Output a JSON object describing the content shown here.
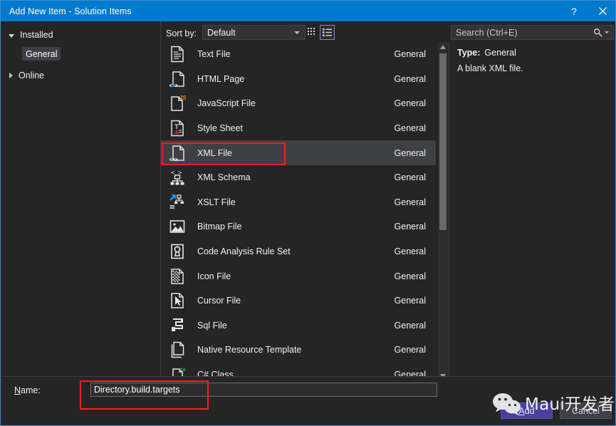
{
  "window": {
    "title": "Add New Item - Solution Items",
    "help_label": "?",
    "close_label": "✕",
    "accent_color": "#007acc",
    "background_color": "#252526"
  },
  "sidebar": {
    "items": [
      {
        "label": "Installed",
        "icon": "triangle-down-icon",
        "expanded": true
      },
      {
        "label": "General",
        "icon": "none",
        "selected": true
      },
      {
        "label": "Online",
        "icon": "triangle-right-icon",
        "expanded": false
      }
    ]
  },
  "toolbar": {
    "sort_label": "Sort by:",
    "sort_value": "Default",
    "view_tiles_icon": "grid-view-icon",
    "view_list_icon": "list-view-icon",
    "view_selected": "list"
  },
  "search": {
    "placeholder": "Search (Ctrl+E)",
    "icon": "magnifier-icon",
    "dropdown_icon": "chevron-down-icon"
  },
  "list": {
    "category_column": "General",
    "selected_index": 4,
    "items": [
      {
        "name": "Text File",
        "category": "General",
        "icon": "text-file-icon"
      },
      {
        "name": "HTML Page",
        "category": "General",
        "icon": "html-page-icon"
      },
      {
        "name": "JavaScript File",
        "category": "General",
        "icon": "javascript-file-icon"
      },
      {
        "name": "Style Sheet",
        "category": "General",
        "icon": "style-sheet-icon"
      },
      {
        "name": "XML File",
        "category": "General",
        "icon": "xml-file-icon"
      },
      {
        "name": "XML Schema",
        "category": "General",
        "icon": "xml-schema-icon"
      },
      {
        "name": "XSLT File",
        "category": "General",
        "icon": "xslt-file-icon"
      },
      {
        "name": "Bitmap File",
        "category": "General",
        "icon": "bitmap-file-icon"
      },
      {
        "name": "Code Analysis Rule Set",
        "category": "General",
        "icon": "rule-set-icon"
      },
      {
        "name": "Icon File",
        "category": "General",
        "icon": "icon-file-icon"
      },
      {
        "name": "Cursor File",
        "category": "General",
        "icon": "cursor-file-icon"
      },
      {
        "name": "Sql File",
        "category": "General",
        "icon": "sql-file-icon"
      },
      {
        "name": "Native Resource Template",
        "category": "General",
        "icon": "native-resource-icon"
      },
      {
        "name": "C# Class",
        "category": "General",
        "icon": "csharp-class-icon"
      }
    ]
  },
  "details": {
    "type_key": "Type:",
    "type_value": "General",
    "description": "A blank XML file."
  },
  "footer": {
    "name_label_prefix": "N",
    "name_label_rest": "ame:",
    "name_value": "Directory.build.targets",
    "add_label_prefix": "A",
    "add_label_rest": "dd",
    "cancel_label": "Cancel"
  },
  "annotations": {
    "color": "#ff1a1a",
    "boxes": [
      "xml-file-row-highlight",
      "name-field-highlight"
    ]
  },
  "watermark": {
    "text": "Maui开发者",
    "icon": "wechat-icon"
  }
}
